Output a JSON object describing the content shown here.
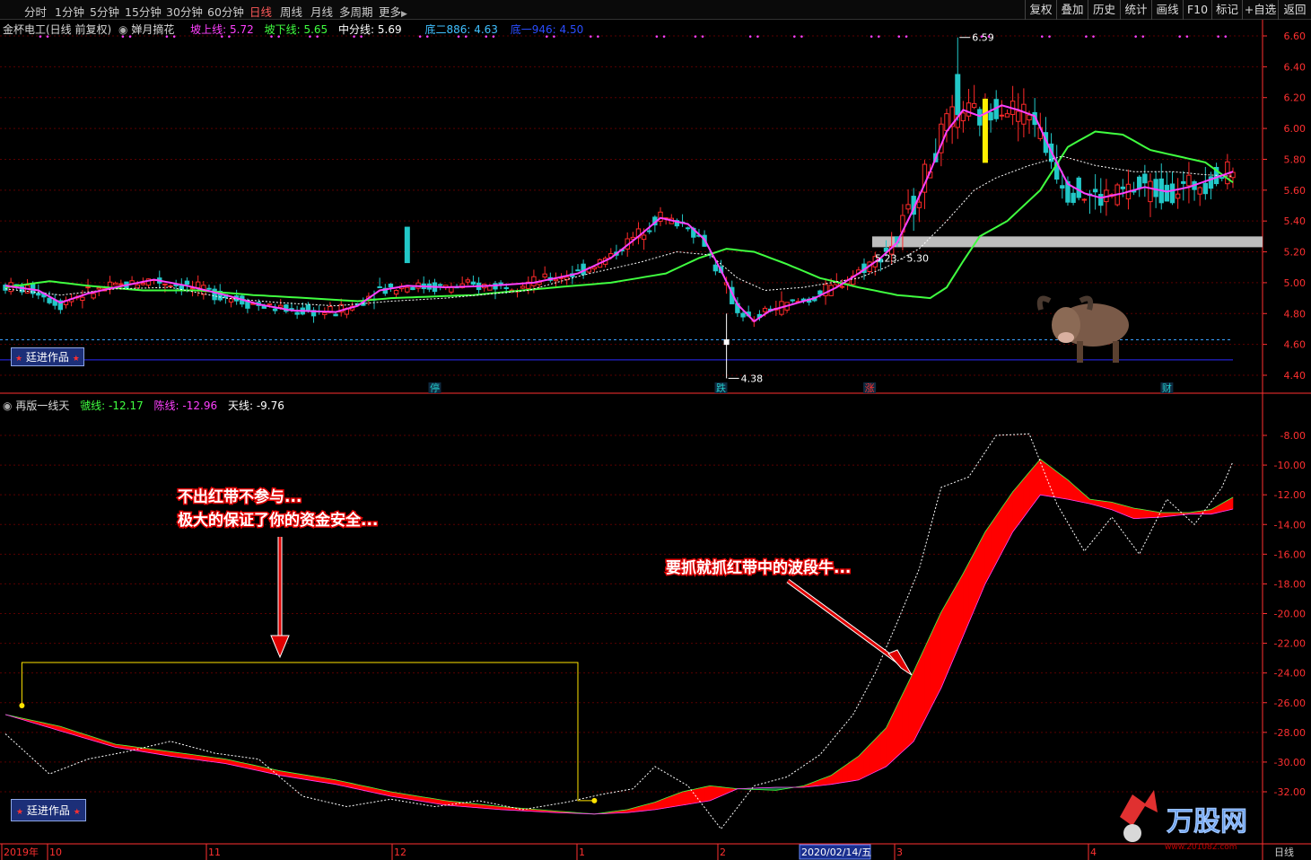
{
  "toolbar": {
    "periods": [
      "分时",
      "1分钟",
      "5分钟",
      "15分钟",
      "30分钟",
      "60分钟",
      "日线",
      "周线",
      "月线",
      "多周期",
      "更多"
    ],
    "active_index": 6,
    "buttons": [
      "复权",
      "叠加",
      "历史",
      "统计",
      "画线",
      "F10",
      "标记",
      "+自选",
      "返回"
    ]
  },
  "main_header": {
    "stock": "金杯电工(日线 前复权)",
    "indicator": "婵月摘花",
    "items": [
      {
        "label": "坡上线:",
        "value": "5.72",
        "color": "#ff40ff"
      },
      {
        "label": "坡下线:",
        "value": "5.65",
        "color": "#40ff40"
      },
      {
        "label": "中分线:",
        "value": "5.69",
        "color": "#ffffff"
      },
      {
        "label": "底二886:",
        "value": "4.63",
        "color": "#40c0ff"
      },
      {
        "label": "底一946:",
        "value": "4.50",
        "color": "#2a4dff"
      }
    ]
  },
  "sub_header": {
    "indicator": "再版一线天",
    "items": [
      {
        "label": "虢线:",
        "value": "-12.17",
        "color": "#40ff40"
      },
      {
        "label": "陈线:",
        "value": "-12.96",
        "color": "#ff40ff"
      },
      {
        "label": "天线:",
        "value": "-9.76",
        "color": "#ffffff"
      }
    ]
  },
  "watermark": "廷进作品",
  "annotations": {
    "a1_line1": "不出红带不参与...",
    "a1_line2": "极大的保证了你的资金安全...",
    "a2": "要抓就抓红带中的波段牛..."
  },
  "events": {
    "e1": "停",
    "e2": "跌",
    "e3": "涨",
    "e4": "财"
  },
  "price_labels": {
    "high": "6.59",
    "low": "4.38",
    "zone": "5.23 - 5.30"
  },
  "x_axis": {
    "year": "2019年",
    "m10": "10",
    "m11": "11",
    "m12": "12",
    "m1": "1",
    "m2": "2",
    "date_box": "2020/02/14/五",
    "m3": "3",
    "m4": "4",
    "period": "日线"
  },
  "logo": {
    "text": "万股网",
    "url": "www.201082.com"
  },
  "colors": {
    "up": "#ff2a2a",
    "down": "#22c8c8",
    "grid": "#5a0000",
    "axis": "#ff3030",
    "upper": "#ff40ff",
    "lower": "#40ff40",
    "band_up": "#ff0000",
    "band_down": "#0d6b34"
  },
  "chart_data": [
    {
      "type": "candlestick",
      "title": "金杯电工(日线 前复权)",
      "yticks": [
        6.6,
        6.4,
        6.2,
        6.0,
        5.8,
        5.6,
        5.4,
        5.2,
        5.0,
        4.8,
        4.6,
        4.4
      ],
      "ylim": [
        4.35,
        6.65
      ],
      "marked_high": 6.59,
      "marked_low": 4.38,
      "resistance_zone": [
        5.23,
        5.3
      ],
      "lines": {
        "坡上线": {
          "last": 5.72,
          "points": [
            [
              0,
              4.98
            ],
            [
              6,
              4.95
            ],
            [
              10,
              4.87
            ],
            [
              15,
              4.93
            ],
            [
              20,
              4.97
            ],
            [
              27,
              5.02
            ],
            [
              33,
              4.98
            ],
            [
              40,
              4.92
            ],
            [
              46,
              4.86
            ],
            [
              52,
              4.82
            ],
            [
              60,
              4.81
            ],
            [
              64,
              4.85
            ],
            [
              68,
              4.95
            ],
            [
              73,
              4.98
            ],
            [
              80,
              4.97
            ],
            [
              88,
              4.98
            ],
            [
              96,
              5.0
            ],
            [
              104,
              5.06
            ],
            [
              110,
              5.16
            ],
            [
              115,
              5.3
            ],
            [
              119,
              5.42
            ],
            [
              124,
              5.38
            ],
            [
              127,
              5.28
            ],
            [
              130,
              5.08
            ],
            [
              133,
              4.86
            ],
            [
              136,
              4.75
            ],
            [
              139,
              4.82
            ],
            [
              143,
              4.86
            ],
            [
              147,
              4.9
            ],
            [
              151,
              4.97
            ],
            [
              155,
              5.06
            ],
            [
              159,
              5.16
            ],
            [
              162,
              5.26
            ],
            [
              165,
              5.48
            ],
            [
              168,
              5.72
            ],
            [
              171,
              5.98
            ],
            [
              174,
              6.12
            ],
            [
              177,
              6.08
            ],
            [
              181,
              6.15
            ],
            [
              184,
              6.12
            ],
            [
              187,
              6.08
            ],
            [
              190,
              5.85
            ],
            [
              193,
              5.64
            ],
            [
              196,
              5.58
            ],
            [
              199,
              5.55
            ],
            [
              203,
              5.58
            ],
            [
              207,
              5.62
            ],
            [
              211,
              5.59
            ],
            [
              215,
              5.62
            ],
            [
              219,
              5.67
            ],
            [
              223,
              5.72
            ]
          ]
        },
        "坡下线": {
          "last": 5.65,
          "points": [
            [
              0,
              4.97
            ],
            [
              8,
              5.01
            ],
            [
              15,
              4.98
            ],
            [
              25,
              4.95
            ],
            [
              35,
              4.95
            ],
            [
              45,
              4.92
            ],
            [
              55,
              4.9
            ],
            [
              64,
              4.88
            ],
            [
              70,
              4.9
            ],
            [
              85,
              4.92
            ],
            [
              100,
              4.97
            ],
            [
              110,
              5.0
            ],
            [
              120,
              5.06
            ],
            [
              126,
              5.16
            ],
            [
              131,
              5.22
            ],
            [
              136,
              5.2
            ],
            [
              142,
              5.12
            ],
            [
              148,
              5.03
            ],
            [
              155,
              4.97
            ],
            [
              162,
              4.92
            ],
            [
              168,
              4.9
            ],
            [
              171,
              4.97
            ],
            [
              174,
              5.14
            ],
            [
              177,
              5.3
            ],
            [
              182,
              5.4
            ],
            [
              188,
              5.6
            ],
            [
              193,
              5.88
            ],
            [
              198,
              5.98
            ],
            [
              203,
              5.96
            ],
            [
              208,
              5.86
            ],
            [
              213,
              5.82
            ],
            [
              218,
              5.78
            ],
            [
              223,
              5.65
            ]
          ]
        },
        "中分线": {
          "last": 5.69,
          "points": [
            [
              0,
              4.96
            ],
            [
              10,
              4.92
            ],
            [
              20,
              4.96
            ],
            [
              30,
              4.97
            ],
            [
              40,
              4.9
            ],
            [
              50,
              4.87
            ],
            [
              60,
              4.85
            ],
            [
              70,
              4.88
            ],
            [
              80,
              4.9
            ],
            [
              95,
              4.95
            ],
            [
              105,
              5.05
            ],
            [
              115,
              5.13
            ],
            [
              122,
              5.2
            ],
            [
              128,
              5.18
            ],
            [
              133,
              5.03
            ],
            [
              138,
              4.95
            ],
            [
              145,
              4.97
            ],
            [
              155,
              5.03
            ],
            [
              160,
              5.1
            ],
            [
              166,
              5.22
            ],
            [
              171,
              5.4
            ],
            [
              176,
              5.6
            ],
            [
              180,
              5.68
            ],
            [
              186,
              5.76
            ],
            [
              192,
              5.82
            ],
            [
              198,
              5.76
            ],
            [
              205,
              5.72
            ],
            [
              212,
              5.72
            ],
            [
              218,
              5.7
            ],
            [
              223,
              5.69
            ]
          ]
        },
        "底二886": 4.63,
        "底一946": 4.5
      }
    },
    {
      "type": "line",
      "title": "再版一线天",
      "yticks": [
        -8,
        -10,
        -12,
        -14,
        -16,
        -18,
        -20,
        -22,
        -24,
        -26,
        -28,
        -30,
        -32
      ],
      "ylim": [
        -33.5,
        -6
      ],
      "series": [
        {
          "name": "虢线",
          "last": -12.17,
          "points": [
            [
              0,
              -26.8
            ],
            [
              10,
              -27.6
            ],
            [
              20,
              -28.8
            ],
            [
              30,
              -29.3
            ],
            [
              40,
              -29.8
            ],
            [
              50,
              -30.6
            ],
            [
              60,
              -31.2
            ],
            [
              70,
              -32.0
            ],
            [
              80,
              -32.6
            ],
            [
              90,
              -33.0
            ],
            [
              100,
              -33.3
            ],
            [
              107,
              -33.5
            ],
            [
              113,
              -33.2
            ],
            [
              118,
              -32.7
            ],
            [
              123,
              -32.0
            ],
            [
              128,
              -31.6
            ],
            [
              133,
              -31.8
            ],
            [
              140,
              -31.9
            ],
            [
              145,
              -31.6
            ],
            [
              150,
              -30.9
            ],
            [
              155,
              -29.6
            ],
            [
              160,
              -27.7
            ],
            [
              165,
              -23.9
            ],
            [
              170,
              -19.9
            ],
            [
              174,
              -17.3
            ],
            [
              178,
              -14.5
            ],
            [
              183,
              -11.8
            ],
            [
              188,
              -9.6
            ],
            [
              193,
              -11.0
            ],
            [
              197,
              -12.3
            ],
            [
              201,
              -12.5
            ],
            [
              205,
              -12.9
            ],
            [
              210,
              -13.2
            ],
            [
              215,
              -13.2
            ],
            [
              219,
              -13.0
            ],
            [
              223,
              -12.17
            ]
          ]
        },
        {
          "name": "陈线",
          "last": -12.96,
          "points": [
            [
              0,
              -26.8
            ],
            [
              10,
              -27.9
            ],
            [
              20,
              -29.0
            ],
            [
              30,
              -29.6
            ],
            [
              40,
              -30.1
            ],
            [
              50,
              -30.9
            ],
            [
              60,
              -31.5
            ],
            [
              70,
              -32.3
            ],
            [
              80,
              -32.9
            ],
            [
              90,
              -33.2
            ],
            [
              100,
              -33.4
            ],
            [
              107,
              -33.5
            ],
            [
              113,
              -33.4
            ],
            [
              118,
              -33.2
            ],
            [
              123,
              -32.9
            ],
            [
              128,
              -32.6
            ],
            [
              133,
              -31.8
            ],
            [
              140,
              -31.7
            ],
            [
              145,
              -31.7
            ],
            [
              150,
              -31.5
            ],
            [
              155,
              -31.2
            ],
            [
              160,
              -30.3
            ],
            [
              165,
              -28.6
            ],
            [
              170,
              -25.0
            ],
            [
              174,
              -21.5
            ],
            [
              178,
              -18.0
            ],
            [
              183,
              -14.5
            ],
            [
              188,
              -12.0
            ],
            [
              193,
              -12.3
            ],
            [
              197,
              -12.6
            ],
            [
              201,
              -13.0
            ],
            [
              205,
              -13.6
            ],
            [
              210,
              -13.5
            ],
            [
              215,
              -13.3
            ],
            [
              219,
              -13.3
            ],
            [
              223,
              -12.96
            ]
          ]
        },
        {
          "name": "天线",
          "last": -9.76,
          "points": [
            [
              0,
              -28.1
            ],
            [
              8,
              -30.8
            ],
            [
              15,
              -29.8
            ],
            [
              22,
              -29.3
            ],
            [
              30,
              -28.6
            ],
            [
              38,
              -29.4
            ],
            [
              46,
              -29.8
            ],
            [
              54,
              -32.3
            ],
            [
              62,
              -33.0
            ],
            [
              70,
              -32.5
            ],
            [
              78,
              -33.0
            ],
            [
              86,
              -32.6
            ],
            [
              94,
              -33.2
            ],
            [
              102,
              -32.7
            ],
            [
              108,
              -32.2
            ],
            [
              114,
              -31.8
            ],
            [
              118,
              -30.3
            ],
            [
              124,
              -31.6
            ],
            [
              130,
              -34.5
            ],
            [
              136,
              -31.6
            ],
            [
              142,
              -31.0
            ],
            [
              148,
              -29.5
            ],
            [
              154,
              -26.8
            ],
            [
              158,
              -24.0
            ],
            [
              162,
              -20.6
            ],
            [
              166,
              -17.0
            ],
            [
              170,
              -11.5
            ],
            [
              175,
              -10.8
            ],
            [
              180,
              -8.0
            ],
            [
              186,
              -7.9
            ],
            [
              191,
              -12.6
            ],
            [
              196,
              -15.8
            ],
            [
              201,
              -13.5
            ],
            [
              206,
              -16.0
            ],
            [
              211,
              -12.3
            ],
            [
              216,
              -14.0
            ],
            [
              221,
              -11.5
            ],
            [
              223,
              -9.76
            ]
          ]
        }
      ]
    }
  ]
}
